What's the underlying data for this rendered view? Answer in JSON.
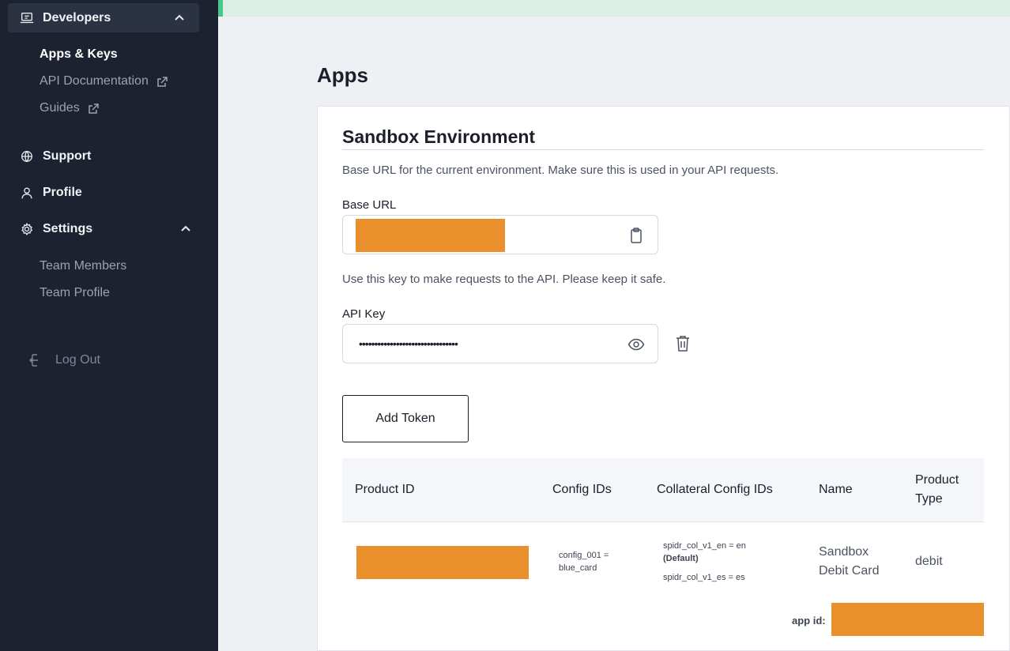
{
  "sidebar": {
    "developers": {
      "label": "Developers",
      "icon": "laptop-icon"
    },
    "dev_items": [
      {
        "label": "Apps & Keys",
        "active": true
      },
      {
        "label": "API Documentation",
        "external": true
      },
      {
        "label": "Guides",
        "external": true
      }
    ],
    "support": {
      "label": "Support",
      "icon": "globe-icon"
    },
    "profile": {
      "label": "Profile",
      "icon": "user-icon"
    },
    "settings": {
      "label": "Settings",
      "icon": "gear-icon"
    },
    "settings_items": [
      {
        "label": "Team Members"
      },
      {
        "label": "Team Profile"
      }
    ],
    "logout": {
      "label": "Log Out",
      "icon": "logout-icon"
    }
  },
  "main": {
    "title": "Apps",
    "section_title": "Sandbox Environment",
    "base_url_desc": "Base URL for the current environment. Make sure this is used in your API requests.",
    "base_url_label": "Base URL",
    "api_key_desc": "Use this key to make requests to the API. Please keep it safe.",
    "api_key_label": "API Key",
    "api_key_masked": "••••••••••••••••••••••••••••••••",
    "add_token_label": "Add Token",
    "table": {
      "headers": [
        "Product ID",
        "Config IDs",
        "Collateral Config IDs",
        "Name",
        "Product Type"
      ],
      "rows": [
        {
          "config_ids": "config_001 = blue_card",
          "collateral_1": "spidr_col_v1_en = en",
          "collateral_default": "(Default)",
          "collateral_2": "spidr_col_v1_es = es",
          "name": "Sandbox Debit Card",
          "product_type": "debit"
        }
      ]
    },
    "app_id_label": "app id:"
  },
  "colors": {
    "sidebar_bg": "#1c2230",
    "accent_green": "#4cc58a",
    "redaction": "#e9902c"
  }
}
